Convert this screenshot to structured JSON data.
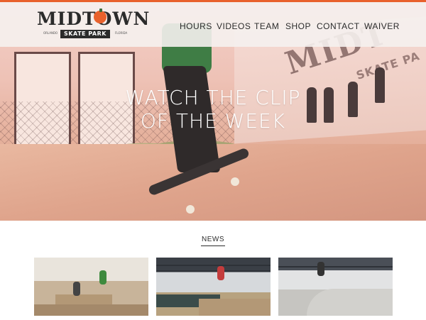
{
  "logo": {
    "wordmark": "MIDTOWN",
    "ribbon": "SKATE PARK",
    "small_left": "ORLANDO",
    "small_right": "FLORIDA"
  },
  "nav": {
    "items": [
      {
        "label": "HOURS"
      },
      {
        "label": "VIDEOS"
      },
      {
        "label": "TEAM"
      },
      {
        "label": "SHOP"
      },
      {
        "label": "CONTACT"
      },
      {
        "label": "WAIVER"
      }
    ]
  },
  "hero": {
    "title_line1": "WATCH THE CLIP",
    "title_line2": "OF THE WEEK",
    "background_sign": "MIDT",
    "background_sign_small": "SKATE PA"
  },
  "news": {
    "heading": "NEWS",
    "thumbnails": [
      {
        "name": "news-thumb-1"
      },
      {
        "name": "news-thumb-2"
      },
      {
        "name": "news-thumb-3"
      }
    ]
  },
  "colors": {
    "accent": "#e8612c",
    "text": "#2b2b2b",
    "header_bg": "#f5f1ee"
  }
}
